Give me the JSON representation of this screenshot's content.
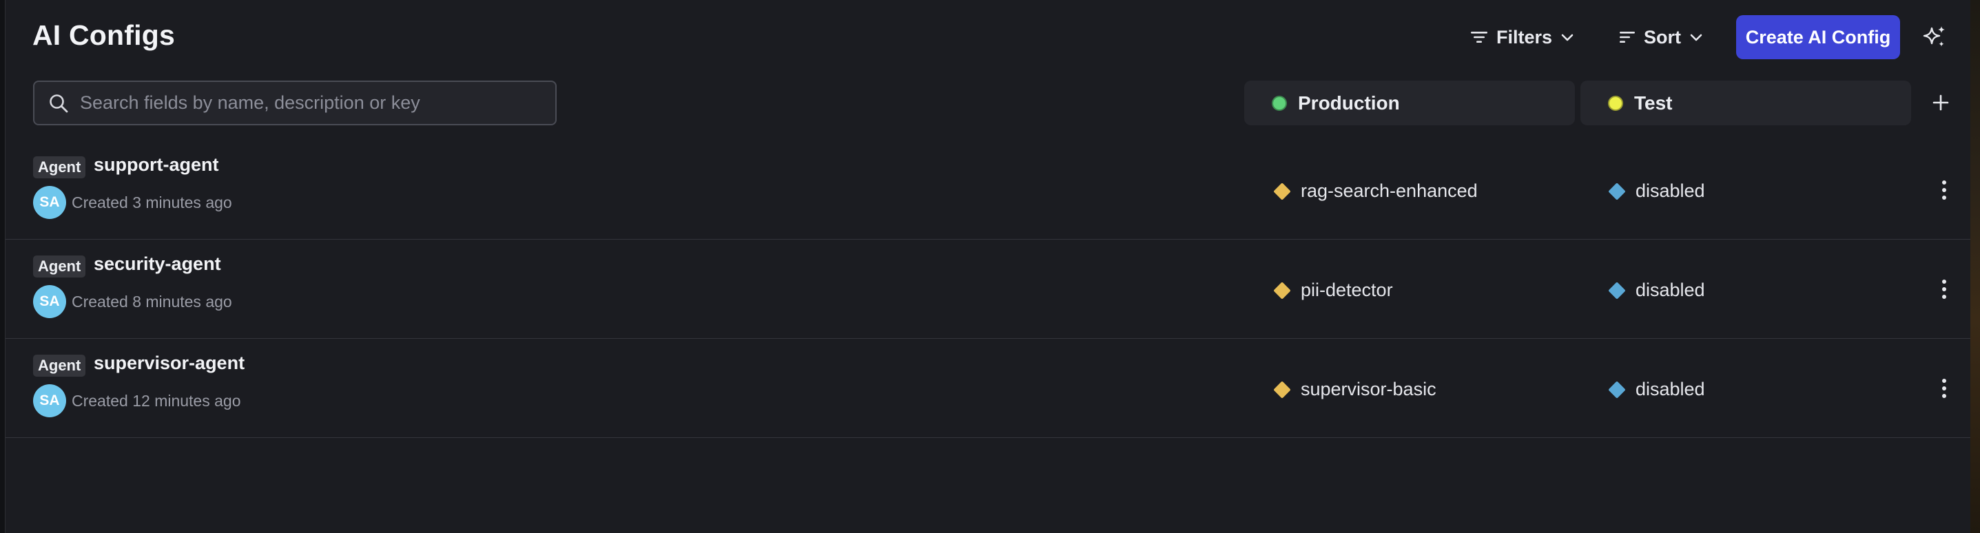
{
  "page": {
    "title": "AI Configs"
  },
  "toolbar": {
    "filters_label": "Filters",
    "sort_label": "Sort",
    "create_label": "Create AI Config"
  },
  "search": {
    "placeholder": "Search fields by name, description or key",
    "value": ""
  },
  "environments": [
    {
      "name": "Production",
      "dot_color": "#5fd17a"
    },
    {
      "name": "Test",
      "dot_color": "#eef14a"
    }
  ],
  "colors": {
    "accent": "#3d44d6",
    "production_variation_diamond": "#e8bd55",
    "test_variation_diamond": "#5aa8d6",
    "avatar": "#6ec6ec"
  },
  "configs": [
    {
      "kind": "Agent",
      "name": "support-agent",
      "avatar_initials": "SA",
      "created": "Created 3 minutes ago",
      "production_variation": "rag-search-enhanced",
      "test_variation": "disabled"
    },
    {
      "kind": "Agent",
      "name": "security-agent",
      "avatar_initials": "SA",
      "created": "Created 8 minutes ago",
      "production_variation": "pii-detector",
      "test_variation": "disabled"
    },
    {
      "kind": "Agent",
      "name": "supervisor-agent",
      "avatar_initials": "SA",
      "created": "Created 12 minutes ago",
      "production_variation": "supervisor-basic",
      "test_variation": "disabled"
    }
  ],
  "icons": [
    "filter-icon",
    "chevron-down-icon",
    "sort-icon",
    "sparkle-icon",
    "search-icon",
    "plus-icon",
    "more-vertical-icon",
    "diamond-icon"
  ]
}
